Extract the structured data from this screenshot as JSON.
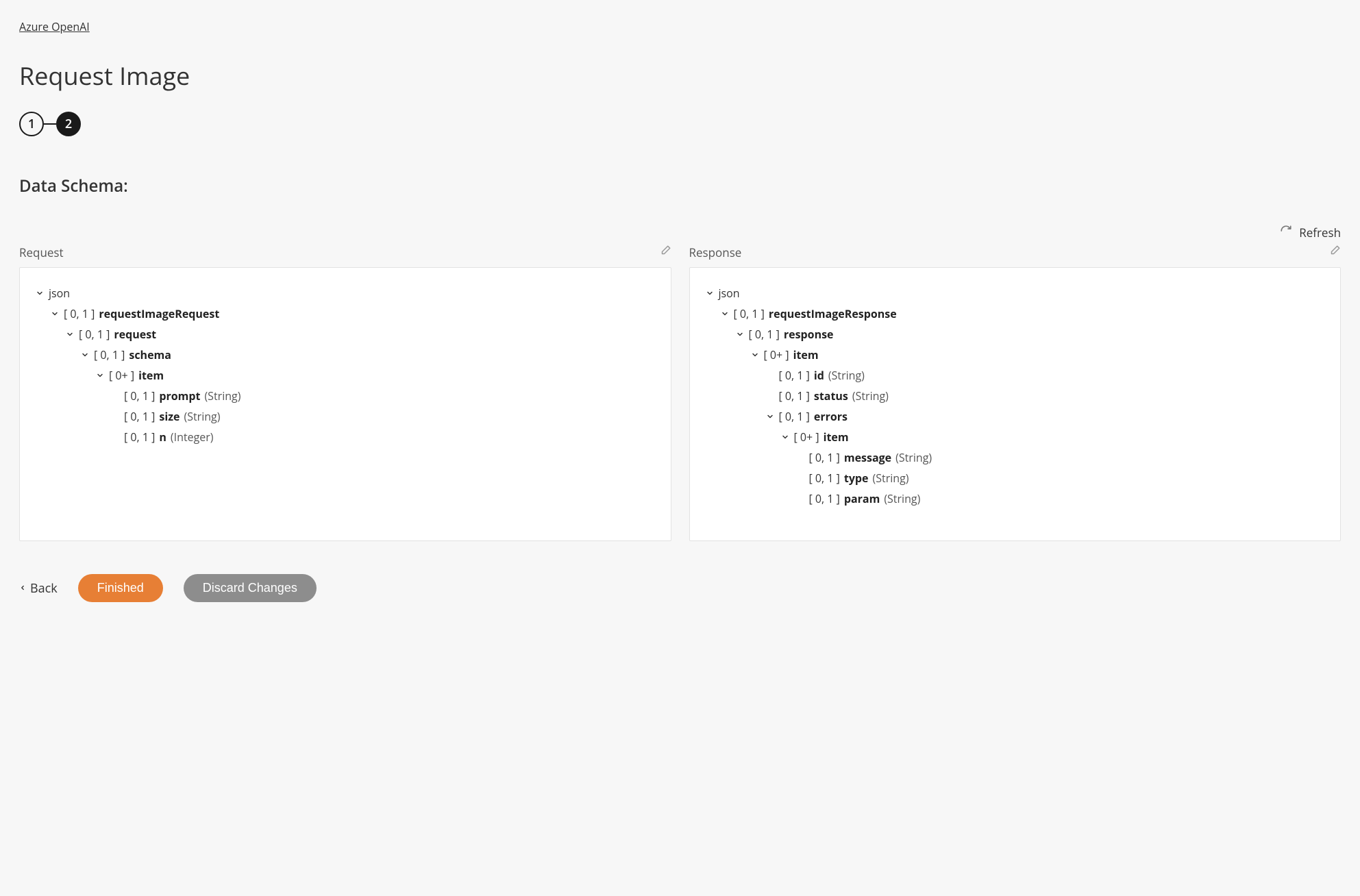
{
  "breadcrumb": "Azure OpenAI",
  "page_title": "Request Image",
  "stepper": {
    "steps": [
      "1",
      "2"
    ],
    "active_index": 1
  },
  "section_title": "Data Schema:",
  "refresh_label": "Refresh",
  "panels": {
    "request": {
      "label": "Request",
      "root_label": "json",
      "tree": [
        {
          "card": "[ 0, 1 ]",
          "name": "requestImageRequest",
          "children": [
            {
              "card": "[ 0, 1 ]",
              "name": "request",
              "children": [
                {
                  "card": "[ 0, 1 ]",
                  "name": "schema",
                  "children": [
                    {
                      "card": "[ 0+ ]",
                      "name": "item",
                      "children": [
                        {
                          "card": "[ 0, 1 ]",
                          "name": "prompt",
                          "type": "(String)"
                        },
                        {
                          "card": "[ 0, 1 ]",
                          "name": "size",
                          "type": "(String)"
                        },
                        {
                          "card": "[ 0, 1 ]",
                          "name": "n",
                          "type": "(Integer)"
                        }
                      ]
                    }
                  ]
                }
              ]
            }
          ]
        }
      ]
    },
    "response": {
      "label": "Response",
      "root_label": "json",
      "tree": [
        {
          "card": "[ 0, 1 ]",
          "name": "requestImageResponse",
          "children": [
            {
              "card": "[ 0, 1 ]",
              "name": "response",
              "children": [
                {
                  "card": "[ 0+ ]",
                  "name": "item",
                  "children": [
                    {
                      "card": "[ 0, 1 ]",
                      "name": "id",
                      "type": "(String)"
                    },
                    {
                      "card": "[ 0, 1 ]",
                      "name": "status",
                      "type": "(String)"
                    },
                    {
                      "card": "[ 0, 1 ]",
                      "name": "errors",
                      "children": [
                        {
                          "card": "[ 0+ ]",
                          "name": "item",
                          "children": [
                            {
                              "card": "[ 0, 1 ]",
                              "name": "message",
                              "type": "(String)"
                            },
                            {
                              "card": "[ 0, 1 ]",
                              "name": "type",
                              "type": "(String)"
                            },
                            {
                              "card": "[ 0, 1 ]",
                              "name": "param",
                              "type": "(String)"
                            }
                          ]
                        }
                      ]
                    }
                  ]
                }
              ]
            }
          ]
        }
      ]
    }
  },
  "footer": {
    "back": "Back",
    "finished": "Finished",
    "discard": "Discard Changes"
  }
}
